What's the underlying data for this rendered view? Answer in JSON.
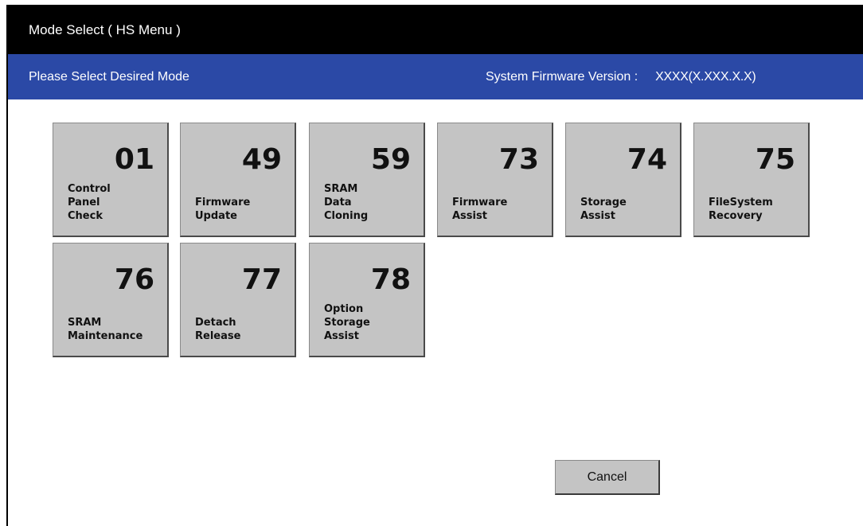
{
  "window": {
    "title": "Mode Select ( HS Menu )"
  },
  "header": {
    "prompt": "Please Select Desired Mode",
    "firmware_label": "System Firmware Version :",
    "firmware_value": "XXXX(X.XXX.X.X)"
  },
  "modes": [
    {
      "number": "01",
      "label": "Control\nPanel\nCheck"
    },
    {
      "number": "49",
      "label": "Firmware\nUpdate"
    },
    {
      "number": "59",
      "label": "SRAM\nData\nCloning"
    },
    {
      "number": "73",
      "label": "Firmware\nAssist"
    },
    {
      "number": "74",
      "label": "Storage\nAssist"
    },
    {
      "number": "75",
      "label": "FileSystem\nRecovery"
    },
    {
      "number": "76",
      "label": "SRAM\nMaintenance"
    },
    {
      "number": "77",
      "label": "Detach\nRelease"
    },
    {
      "number": "78",
      "label": "Option\nStorage\nAssist"
    }
  ],
  "footer": {
    "cancel_label": "Cancel"
  },
  "colors": {
    "title_bar": "#000000",
    "header_bar": "#2b49a6",
    "tile": "#c4c4c4"
  }
}
